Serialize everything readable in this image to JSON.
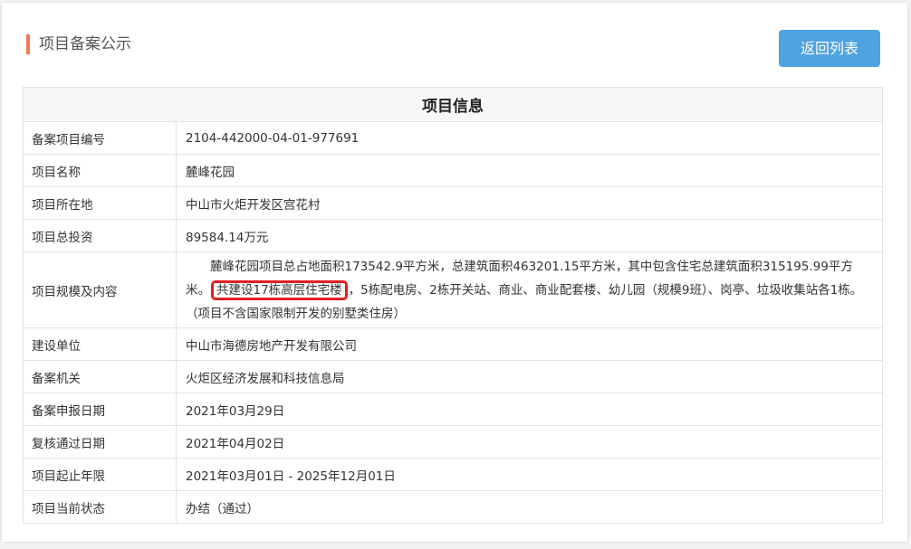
{
  "page": {
    "title": "项目备案公示",
    "back_button": "返回列表"
  },
  "table": {
    "title": "项目信息",
    "rows": [
      {
        "label": "备案项目编号",
        "value": "2104-442000-04-01-977691"
      },
      {
        "label": "项目名称",
        "value": "麓峰花园"
      },
      {
        "label": "项目所在地",
        "value": "中山市火炬开发区宫花村"
      },
      {
        "label": "项目总投资",
        "value": "89584.14万元"
      },
      {
        "label": "项目规模及内容",
        "value_before": "麓峰花园项目总占地面积173542.9平方米，总建筑面积463201.15平方米，其中包含住宅总建筑面积315195.99平方米。",
        "value_highlight": "共建设17栋高层住宅楼",
        "value_after": "，5栋配电房、2栋开关站、商业、商业配套楼、幼儿园（规模9班）、岗亭、垃圾收集站各1栋。（项目不含国家限制开发的别墅类住房）"
      },
      {
        "label": "建设单位",
        "value": "中山市海德房地产开发有限公司"
      },
      {
        "label": "备案机关",
        "value": "火炬区经济发展和科技信息局"
      },
      {
        "label": "备案申报日期",
        "value": "2021年03月29日"
      },
      {
        "label": "复核通过日期",
        "value": "2021年04月02日"
      },
      {
        "label": "项目起止年限",
        "value": "2021年03月01日 - 2025年12月01日"
      },
      {
        "label": "项目当前状态",
        "value": "办结（通过）"
      }
    ]
  },
  "colors": {
    "accent_bar": "#f07a52",
    "button": "#4fa3e0",
    "highlight_box": "#e21f1f"
  }
}
